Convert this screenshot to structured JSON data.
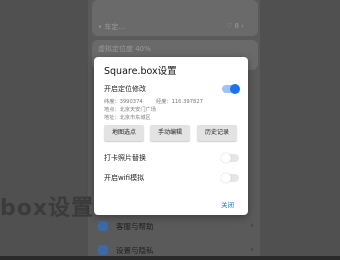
{
  "background": {
    "header_text": "• 车定...",
    "header_right": "♡ 8 ›",
    "percent_text": "虚拟定位度 40%",
    "big_text": "box设置",
    "rows": [
      {
        "label": "客服与帮助"
      },
      {
        "label": "设置与隐私"
      }
    ]
  },
  "dialog": {
    "title": "Square.box设置",
    "location_toggle_label": "开启定位修改",
    "location_toggle_on": true,
    "latitude": "纬度：3990374",
    "longitude": "经度：116.397827",
    "place": "地点：北京天安门广场",
    "address": "地址：北京市东城区",
    "buttons": {
      "map_pick": "地图选点",
      "manual_edit": "手动编辑",
      "history": "历史记录"
    },
    "photo_replace_label": "打卡照片替换",
    "photo_replace_on": false,
    "wifi_sim_label": "开启wifi模拟",
    "wifi_sim_on": false,
    "close_label": "关闭"
  }
}
